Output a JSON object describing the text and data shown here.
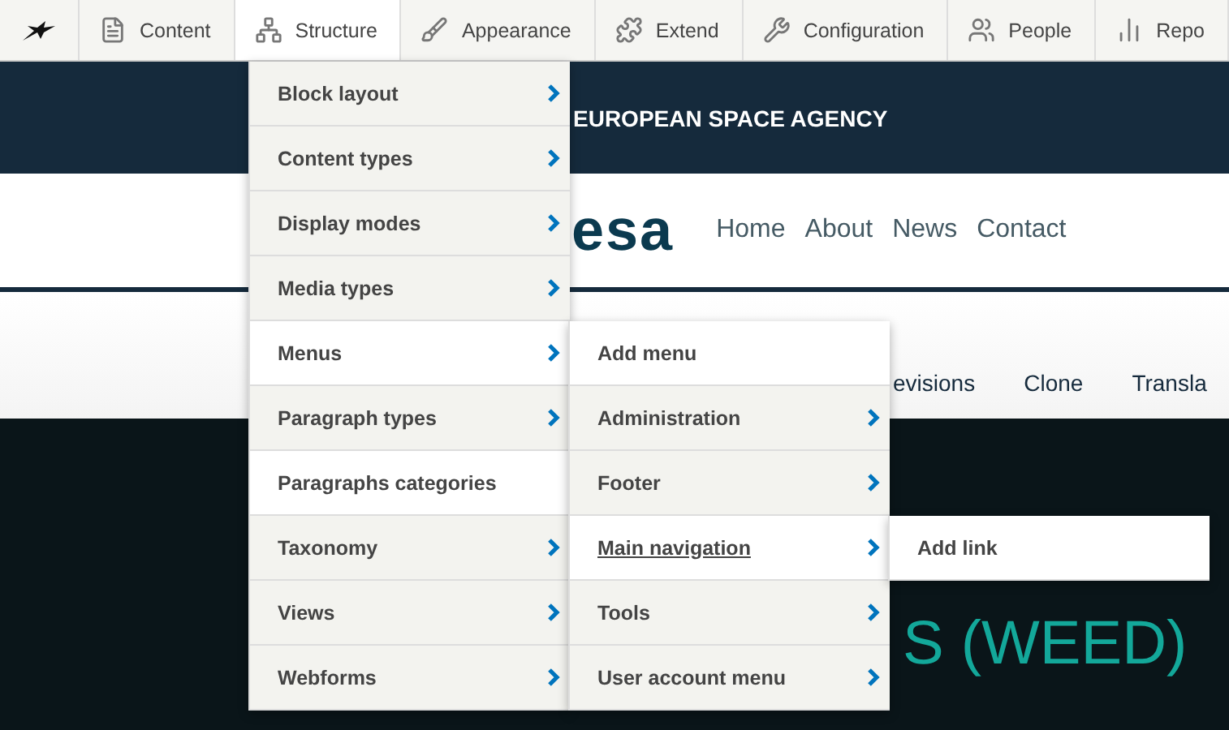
{
  "toolbar": {
    "items": [
      {
        "label": "Content",
        "selected": false
      },
      {
        "label": "Structure",
        "selected": true
      },
      {
        "label": "Appearance",
        "selected": false
      },
      {
        "label": "Extend",
        "selected": false
      },
      {
        "label": "Configuration",
        "selected": false
      },
      {
        "label": "People",
        "selected": false
      },
      {
        "label": "Repo",
        "selected": false
      }
    ]
  },
  "site_header": {
    "agency": "EUROPEAN SPACE AGENCY",
    "logo": "esa",
    "nav": [
      "Home",
      "About",
      "News",
      "Contact"
    ]
  },
  "page_tabs": [
    "evisions",
    "Clone",
    "Transla"
  ],
  "hero": {
    "title": "S (WEED)"
  },
  "menu": [
    {
      "label": "Block layout",
      "has_children": true,
      "expanded": false
    },
    {
      "label": "Content types",
      "has_children": true,
      "expanded": false
    },
    {
      "label": "Display modes",
      "has_children": true,
      "expanded": false
    },
    {
      "label": "Media types",
      "has_children": true,
      "expanded": false
    },
    {
      "label": "Menus",
      "has_children": true,
      "expanded": true,
      "children": [
        {
          "label": "Add menu",
          "has_children": false,
          "expanded": false,
          "focused": false
        },
        {
          "label": "Administration",
          "has_children": true,
          "expanded": false,
          "focused": false
        },
        {
          "label": "Footer",
          "has_children": true,
          "expanded": false,
          "focused": false
        },
        {
          "label": "Main navigation",
          "has_children": true,
          "expanded": true,
          "focused": true,
          "children": [
            {
              "label": "Add link",
              "has_children": false,
              "expanded": false,
              "focused": false
            }
          ]
        },
        {
          "label": "Tools",
          "has_children": true,
          "expanded": false,
          "focused": false
        },
        {
          "label": "User account menu",
          "has_children": true,
          "expanded": false,
          "focused": false
        }
      ]
    },
    {
      "label": "Paragraph types",
      "has_children": true,
      "expanded": false
    },
    {
      "label": "Paragraphs categories",
      "has_children": false,
      "expanded": false
    },
    {
      "label": "Taxonomy",
      "has_children": true,
      "expanded": false
    },
    {
      "label": "Views",
      "has_children": true,
      "expanded": false
    },
    {
      "label": "Webforms",
      "has_children": true,
      "expanded": false
    }
  ]
}
